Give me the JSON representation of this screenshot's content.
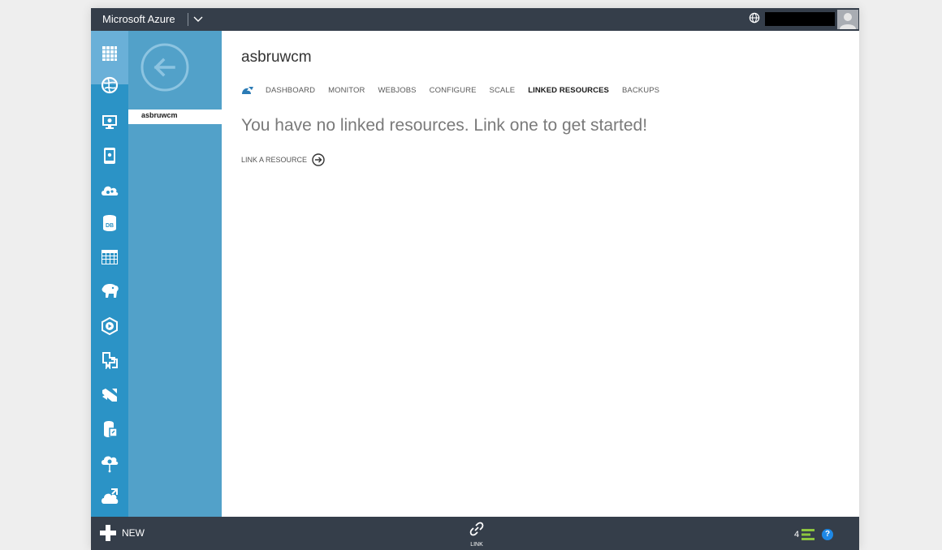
{
  "topbar": {
    "brand": "Microsoft Azure"
  },
  "rail": {
    "icons": [
      "all-items-icon",
      "web-sites-icon",
      "virtual-machines-icon",
      "mobile-services-icon",
      "cloud-services-icon",
      "sql-databases-icon",
      "storage-icon",
      "hdinsight-icon",
      "media-services-icon",
      "service-bus-icon",
      "visual-studio-online-icon",
      "cache-icon",
      "biztalk-services-icon",
      "recovery-services-icon"
    ]
  },
  "panel": {
    "selected_item": "asbruwcm"
  },
  "main": {
    "site_title": "asbruwcm",
    "tabs": [
      {
        "label": "DASHBOARD",
        "active": false
      },
      {
        "label": "MONITOR",
        "active": false
      },
      {
        "label": "WEBJOBS",
        "active": false
      },
      {
        "label": "CONFIGURE",
        "active": false
      },
      {
        "label": "SCALE",
        "active": false
      },
      {
        "label": "LINKED RESOURCES",
        "active": true
      },
      {
        "label": "BACKUPS",
        "active": false
      }
    ],
    "empty_message": "You have no linked resources. Link one to get started!",
    "link_resource_label": "LINK A RESOURCE"
  },
  "bottombar": {
    "new_label": "NEW",
    "link_label": "LINK",
    "notification_count": "4",
    "help_label": "?"
  },
  "colors": {
    "topbar": "#353e4a",
    "rail": "#2b93c6",
    "panel": "#52a1c9",
    "accent_green": "#8dc63f",
    "help_blue": "#1e88e5"
  }
}
